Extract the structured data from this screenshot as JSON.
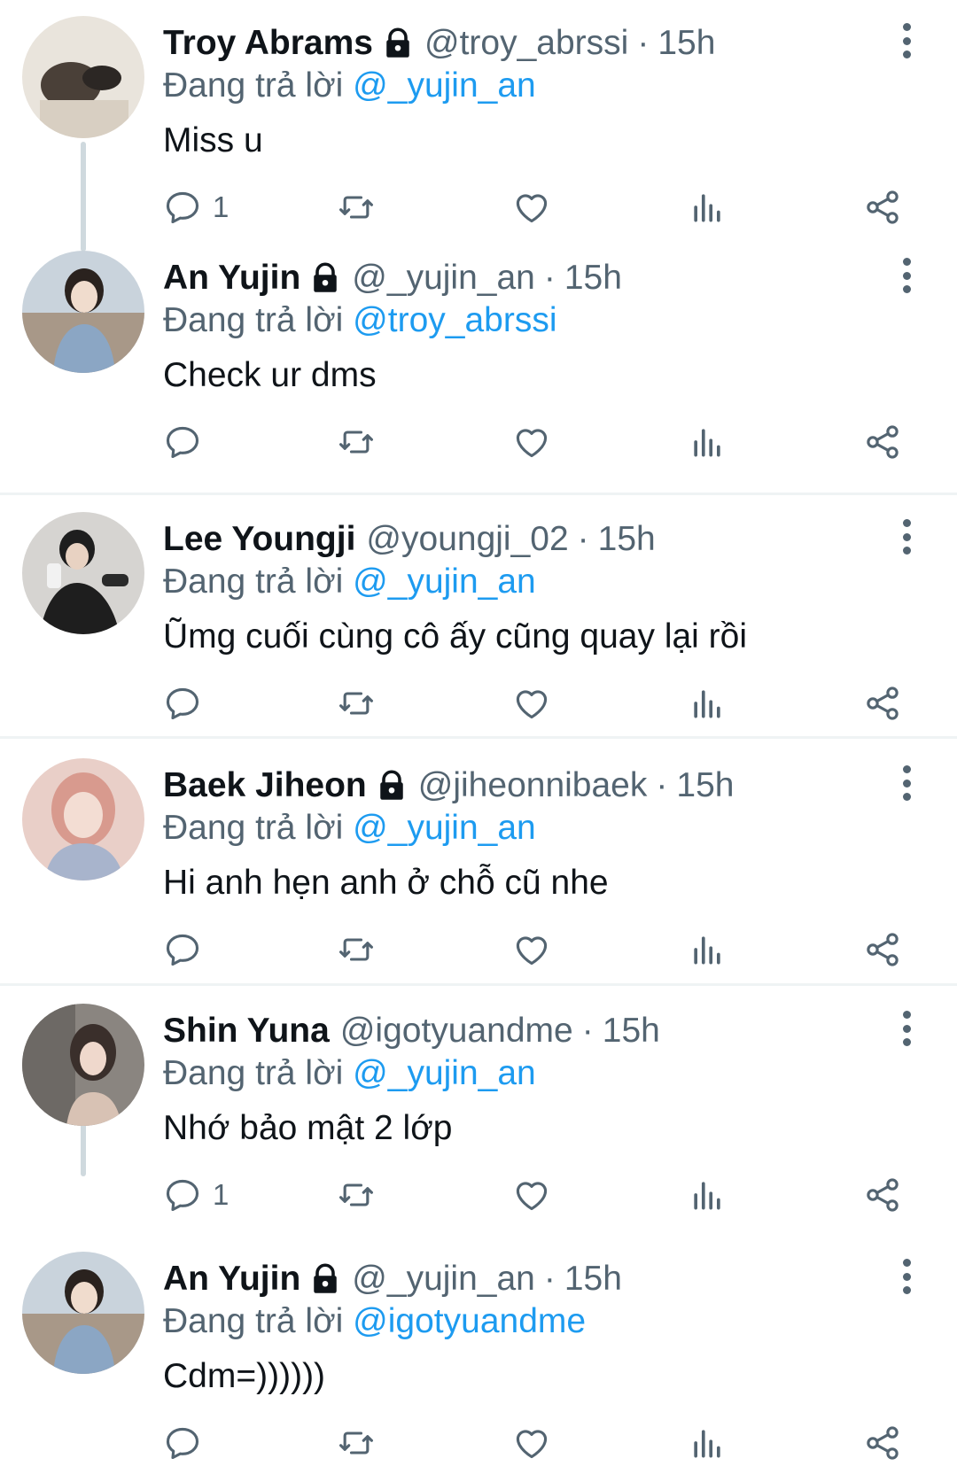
{
  "reply_prefix": "Đang trả lời",
  "tweets": [
    {
      "name": "Troy Abrams",
      "locked": true,
      "handle": "@troy_abrssi",
      "separator": "·",
      "time": "15h",
      "reply_to": "@_yujin_an",
      "text": "Miss u",
      "reply_count": "1",
      "avatar_bg": "#e9e4dc",
      "avatar_fg": "#4a4038"
    },
    {
      "name": "An Yujin",
      "locked": true,
      "handle": "@_yujin_an",
      "separator": "·",
      "time": "15h",
      "reply_to": "@troy_abrssi",
      "text": "Check ur dms",
      "reply_count": "",
      "avatar_bg": "#b8c6d2",
      "avatar_fg": "#8ba6c4"
    },
    {
      "name": "Lee Youngji",
      "locked": false,
      "handle": "@youngji_02",
      "separator": "·",
      "time": "15h",
      "reply_to": "@_yujin_an",
      "text": "Ũmg cuối cùng cô ấy cũng quay lại rồi",
      "reply_count": "",
      "avatar_bg": "#d6d4d1",
      "avatar_fg": "#1e1e1e"
    },
    {
      "name": "Baek Jiheon",
      "locked": true,
      "handle": "@jiheonnibaek",
      "separator": "·",
      "time": "15h",
      "reply_to": "@_yujin_an",
      "text": "Hi anh hẹn anh ở chỗ cũ nhe",
      "reply_count": "",
      "avatar_bg": "#e9cfc8",
      "avatar_fg": "#d89a8e"
    },
    {
      "name": "Shin Yuna",
      "locked": false,
      "handle": "@igotyuandme",
      "separator": "·",
      "time": "15h",
      "reply_to": "@_yujin_an",
      "text": "Nhớ bảo mật 2 lớp",
      "reply_count": "1",
      "avatar_bg": "#8a8580",
      "avatar_fg": "#3a2f2b"
    },
    {
      "name": "An Yujin",
      "locked": true,
      "handle": "@_yujin_an",
      "separator": "·",
      "time": "15h",
      "reply_to": "@igotyuandme",
      "text": "Cdm=))))))",
      "reply_count": "",
      "avatar_bg": "#b8c6d2",
      "avatar_fg": "#8ba6c4"
    }
  ],
  "colors": {
    "text": "#0f1419",
    "secondary": "#536471",
    "mention": "#1d9bf0",
    "divider": "#eff3f4",
    "thread_line": "#cfd9de"
  },
  "icons": {
    "lock": "lock-icon",
    "more": "more-vertical-icon",
    "reply": "reply-bubble-icon",
    "retweet": "retweet-icon",
    "like": "heart-icon",
    "views": "views-bar-chart-icon",
    "share": "share-icon"
  }
}
